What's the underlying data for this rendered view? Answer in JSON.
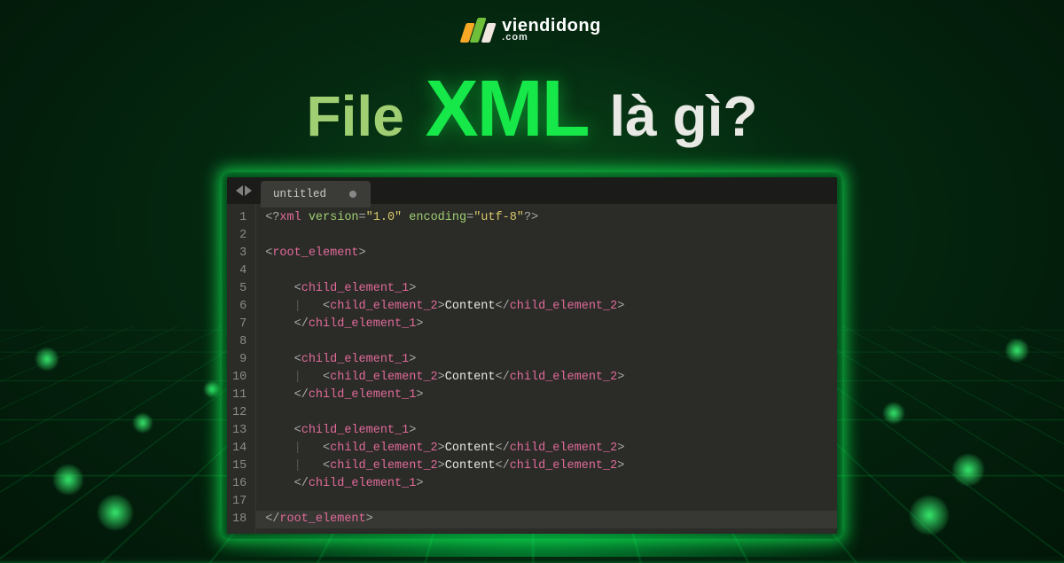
{
  "brand": {
    "name": "viendidong",
    "domain": ".com"
  },
  "headline": {
    "part1": "File ",
    "part2": "XML",
    "part3": " là gì?"
  },
  "editor": {
    "tab_title": "untitled",
    "lines": [
      {
        "n": "1",
        "html": "<span class='p'>&lt;?</span><span class='q'>xml</span> <span class='a'>version</span><span class='p'>=</span><span class='s'>\"1.0\"</span> <span class='a'>encoding</span><span class='p'>=</span><span class='s'>\"utf-8\"</span><span class='p'>?&gt;</span>"
      },
      {
        "n": "2",
        "html": ""
      },
      {
        "n": "3",
        "html": "<span class='p'>&lt;</span><span class='t'>root_element</span><span class='p'>&gt;</span>"
      },
      {
        "n": "4",
        "html": ""
      },
      {
        "n": "5",
        "html": "    <span class='p'>&lt;</span><span class='t'>child_element_1</span><span class='p'>&gt;</span>"
      },
      {
        "n": "6",
        "html": "    <span class='ind'>|</span>   <span class='p'>&lt;</span><span class='t'>child_element_2</span><span class='p'>&gt;</span><span class='c'>Content</span><span class='p'>&lt;/</span><span class='t'>child_element_2</span><span class='p'>&gt;</span>"
      },
      {
        "n": "7",
        "html": "    <span class='p'>&lt;/</span><span class='t'>child_element_1</span><span class='p'>&gt;</span>"
      },
      {
        "n": "8",
        "html": ""
      },
      {
        "n": "9",
        "html": "    <span class='p'>&lt;</span><span class='t'>child_element_1</span><span class='p'>&gt;</span>"
      },
      {
        "n": "10",
        "html": "    <span class='ind'>|</span>   <span class='p'>&lt;</span><span class='t'>child_element_2</span><span class='p'>&gt;</span><span class='c'>Content</span><span class='p'>&lt;/</span><span class='t'>child_element_2</span><span class='p'>&gt;</span>"
      },
      {
        "n": "11",
        "html": "    <span class='p'>&lt;/</span><span class='t'>child_element_1</span><span class='p'>&gt;</span>"
      },
      {
        "n": "12",
        "html": ""
      },
      {
        "n": "13",
        "html": "    <span class='p'>&lt;</span><span class='t'>child_element_1</span><span class='p'>&gt;</span>"
      },
      {
        "n": "14",
        "html": "    <span class='ind'>|</span>   <span class='p'>&lt;</span><span class='t'>child_element_2</span><span class='p'>&gt;</span><span class='c'>Content</span><span class='p'>&lt;/</span><span class='t'>child_element_2</span><span class='p'>&gt;</span>"
      },
      {
        "n": "15",
        "html": "    <span class='ind'>|</span>   <span class='p'>&lt;</span><span class='t'>child_element_2</span><span class='p'>&gt;</span><span class='c'>Content</span><span class='p'>&lt;/</span><span class='t'>child_element_2</span><span class='p'>&gt;</span>"
      },
      {
        "n": "16",
        "html": "    <span class='p'>&lt;/</span><span class='t'>child_element_1</span><span class='p'>&gt;</span>"
      },
      {
        "n": "17",
        "html": ""
      },
      {
        "n": "18",
        "html": "<span class='p'>&lt;/</span><span class='t'>root_element</span><span class='p'>&gt;</span>",
        "hl": true
      }
    ]
  }
}
